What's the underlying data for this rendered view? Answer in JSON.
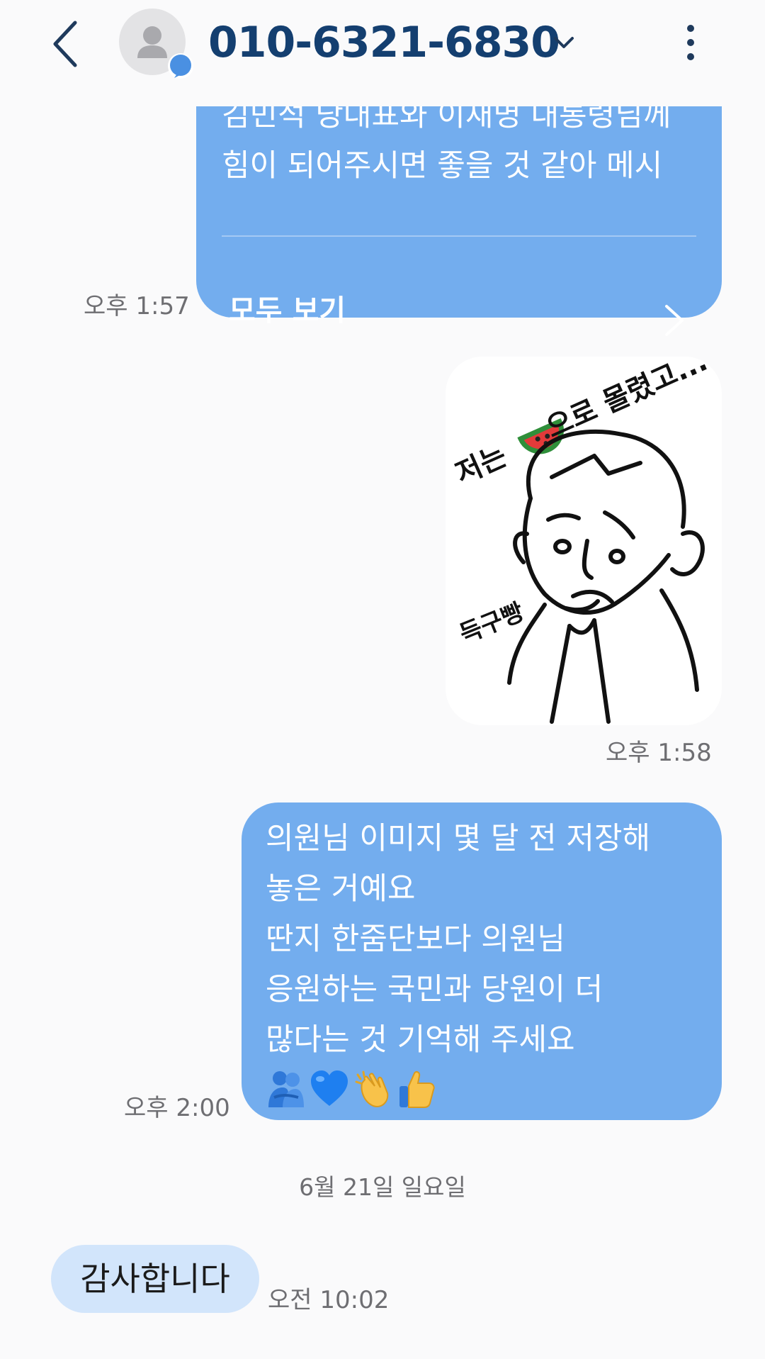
{
  "header": {
    "contact_name": "010-6321-6830",
    "icons": [
      "back-arrow-icon",
      "contact-avatar-icon",
      "chat-badge-icon",
      "chevron-down-icon",
      "more-vertical-icon"
    ]
  },
  "messages": {
    "m1": {
      "lines": [
        "김민석 당대표와 이재명 대통령님께",
        "힘이 되어주시면 좋을 것 같아 메시"
      ],
      "see_all_label": "모두 보기",
      "time": "오후 1:57"
    },
    "m2": {
      "sticker_caption": "저는 🍉 으로 몰렸고...",
      "sticker_side_text": "득구빵",
      "time": "오후 1:58"
    },
    "m3": {
      "lines": [
        "의원님 이미지 몇 달 전 저장해",
        "놓은 거예요",
        "딴지 한줌단보다 의원님",
        "응원하는 국민과 당원이 더",
        "많다는 것 기억해 주세요"
      ],
      "emojis": [
        "people-hugging-emoji",
        "blue-heart-emoji",
        "clapping-hands-emoji",
        "thumbs-up-emoji"
      ],
      "time": "오후 2:00"
    },
    "date_separator": "6월 21일 일요일",
    "m4": {
      "text": "감사합니다",
      "time": "오전 10:02"
    }
  },
  "colors": {
    "outgoing_bubble": "#73adee",
    "incoming_bubble": "#d2e5fb",
    "title": "#143f70",
    "background": "#fafafb",
    "timestamp": "#6e6e72"
  }
}
